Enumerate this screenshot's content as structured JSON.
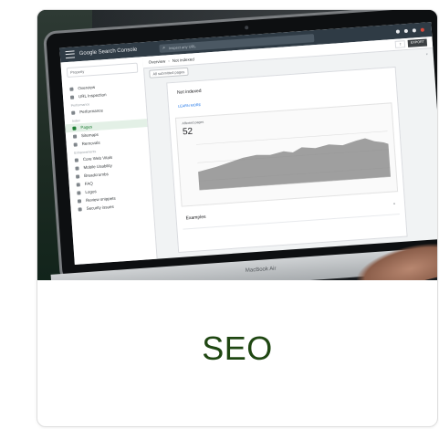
{
  "card": {
    "title": "SEO"
  },
  "screen": {
    "product_name": "Google Search Console",
    "search_placeholder": "Inspect any URL",
    "sidebar": {
      "property": "Property",
      "items": [
        {
          "label": "Overview",
          "active": false
        },
        {
          "label": "URL Inspection",
          "active": false
        },
        {
          "label": "Performance",
          "active": false
        },
        {
          "label": "Pages",
          "active": true
        },
        {
          "label": "Sitemaps",
          "active": false
        },
        {
          "label": "Removals",
          "active": false
        },
        {
          "label": "Core Web Vitals",
          "active": false
        },
        {
          "label": "Mobile Usability",
          "active": false
        },
        {
          "label": "Breadcrumbs",
          "active": false
        },
        {
          "label": "FAQ",
          "active": false
        },
        {
          "label": "Logos",
          "active": false
        },
        {
          "label": "Review snippets",
          "active": false
        },
        {
          "label": "Security issues",
          "active": false
        }
      ],
      "section_labels": [
        "Performance",
        "Index",
        "Enhancements"
      ]
    },
    "breadcrumb": [
      "Overview",
      "Not indexed"
    ],
    "export_label": "EXPORT",
    "filter_label": "All submitted pages",
    "panel": {
      "title": "Not indexed",
      "link": "LEARN MORE",
      "metric_label": "Affected pages",
      "metric_value": "52",
      "examples_title": "Examples"
    },
    "device_brand": "MacBook Air"
  },
  "colors": {
    "caption_text": "#1f4712",
    "active_nav": "#1e7e34",
    "chart_fill": "#8e8e8e"
  }
}
